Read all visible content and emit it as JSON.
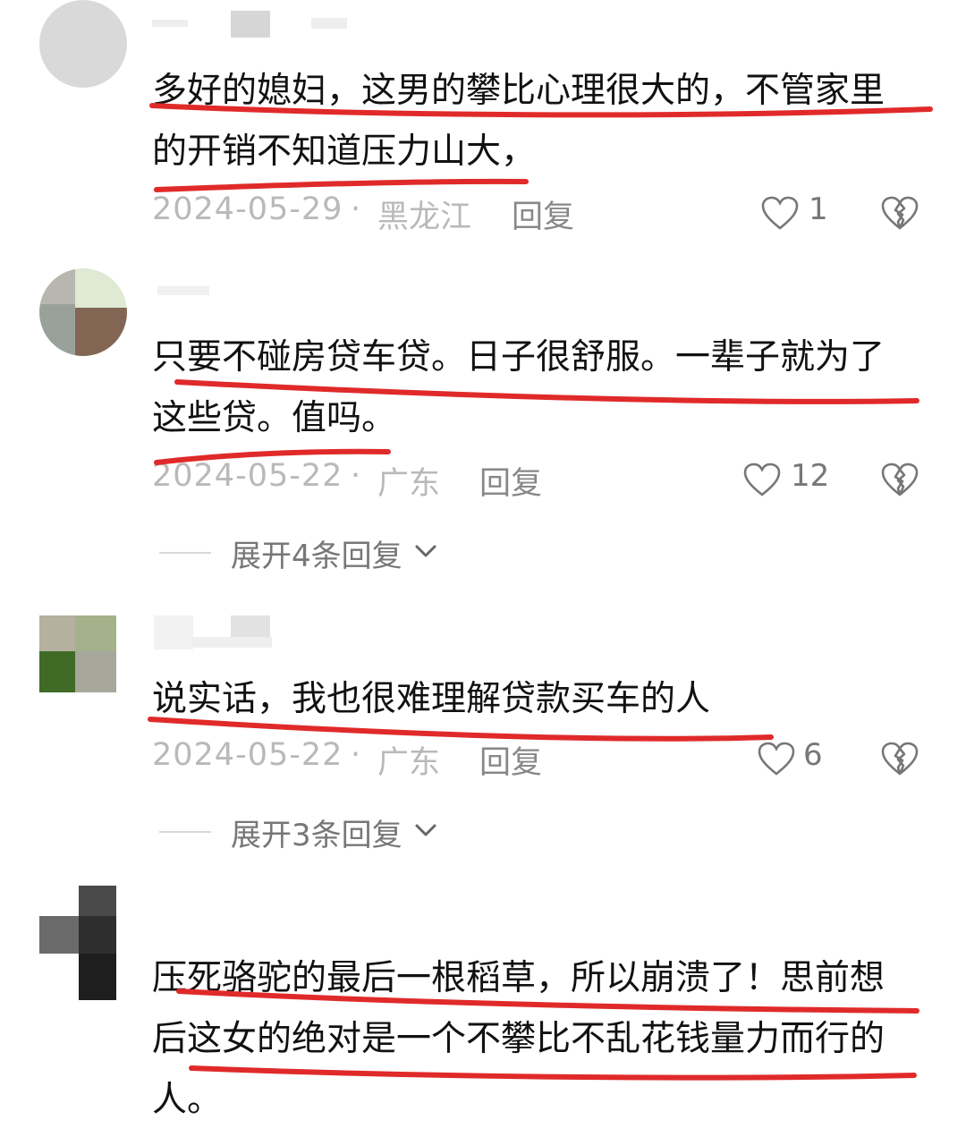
{
  "comments": [
    {
      "text_lines": [
        "多好的媳妇，这男的攀比心理很大的，不管家里",
        "的开销不知道压力山大，"
      ],
      "date": "2024-05-29",
      "location": "黑龙江",
      "reply_label": "回复",
      "likes": "1"
    },
    {
      "text_lines": [
        "只要不碰房贷车贷。日子很舒服。一辈子就为了",
        "这些贷。值吗。"
      ],
      "date": "2024-05-22",
      "location": "广东",
      "reply_label": "回复",
      "likes": "12",
      "expand_label": "展开4条回复"
    },
    {
      "text_lines": [
        "说实话，我也很难理解贷款买车的人"
      ],
      "date": "2024-05-22",
      "location": "广东",
      "reply_label": "回复",
      "likes": "6",
      "expand_label": "展开3条回复"
    },
    {
      "text_lines": [
        "压死骆驼的最后一根稻草，所以崩溃了！思前想",
        "后这女的绝对是一个不攀比不乱花钱量力而行的",
        "人。"
      ]
    }
  ],
  "separator": "·",
  "colors": {
    "underline": "#e02a2a",
    "text": "#111111",
    "meta": "#b9b9b9"
  }
}
